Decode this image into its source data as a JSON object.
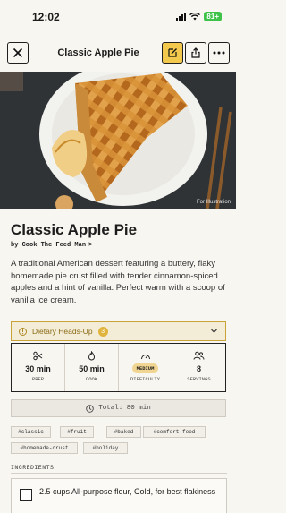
{
  "status": {
    "time": "12:02",
    "battery": "81+"
  },
  "header": {
    "title": "Classic Apple Pie"
  },
  "hero": {
    "caption": "For Illustration"
  },
  "recipe": {
    "title": "Classic Apple Pie",
    "byline": "by Cook The Feed Man",
    "description": "A traditional American dessert featuring a buttery, flaky homemade pie crust filled with tender cinnamon-spiced apples and a hint of vanilla. Perfect warm with a scoop of vanilla ice cream."
  },
  "dietary": {
    "label": "Dietary Heads-Up",
    "count": "3"
  },
  "stats": {
    "prep": {
      "value": "30 min",
      "label": "PREP"
    },
    "cook": {
      "value": "50 min",
      "label": "COOK"
    },
    "difficulty": {
      "value": "MEDIUM",
      "label": "DIFFICULTY"
    },
    "servings": {
      "value": "8",
      "label": "SERVINGS"
    }
  },
  "total": "Total: 80 min",
  "tags": [
    "#classic",
    "#fruit",
    "#baked",
    "#comfort-food",
    "#homemade-crust",
    "#holiday"
  ],
  "ingredients": {
    "heading": "INGREDIENTS",
    "items": [
      "2.5 cups All-purpose flour, Cold, for best flakiness"
    ]
  },
  "icons": {
    "close": "close-icon",
    "edit": "edit-icon",
    "share": "share-icon",
    "more": "more-icon",
    "prep": "scissors-icon",
    "cook": "flame-icon",
    "difficulty": "gauge-icon",
    "servings": "people-icon",
    "clock": "clock-icon",
    "dietary": "info-icon"
  },
  "colors": {
    "accent": "#f2c94c",
    "background": "#f8f6f1",
    "warning": "#c9a23a",
    "battery": "#3ec24a"
  }
}
